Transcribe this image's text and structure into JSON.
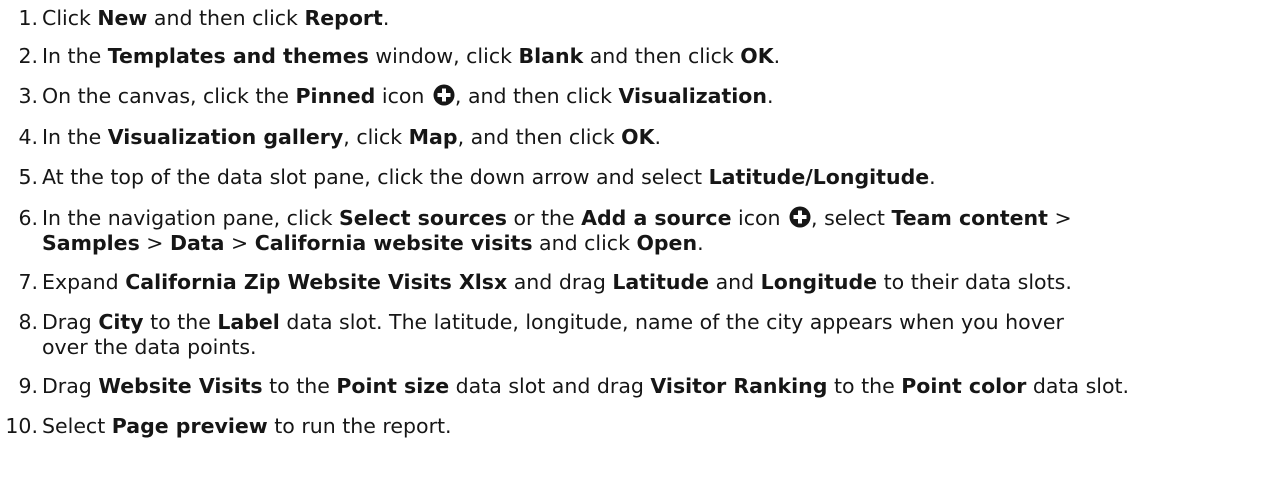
{
  "steps": [
    {
      "num": "1.",
      "segments": [
        {
          "t": "Click "
        },
        {
          "t": "New",
          "b": true
        },
        {
          "t": " and then click "
        },
        {
          "t": "Report",
          "b": true
        },
        {
          "t": "."
        }
      ]
    },
    {
      "num": "2.",
      "segments": [
        {
          "t": "In the "
        },
        {
          "t": "Templates and themes",
          "b": true
        },
        {
          "t": " window, click "
        },
        {
          "t": "Blank",
          "b": true
        },
        {
          "t": " and then click "
        },
        {
          "t": "OK",
          "b": true
        },
        {
          "t": "."
        }
      ]
    },
    {
      "num": "3.",
      "segments": [
        {
          "t": "On the canvas, click the "
        },
        {
          "t": "Pinned",
          "b": true
        },
        {
          "t": " icon "
        },
        {
          "icon": "add-circle-icon"
        },
        {
          "t": ", and then click "
        },
        {
          "t": "Visualization",
          "b": true
        },
        {
          "t": "."
        }
      ]
    },
    {
      "num": "4.",
      "segments": [
        {
          "t": "In the "
        },
        {
          "t": "Visualization gallery",
          "b": true
        },
        {
          "t": ", click "
        },
        {
          "t": "Map",
          "b": true
        },
        {
          "t": ", and then click "
        },
        {
          "t": "OK",
          "b": true
        },
        {
          "t": "."
        }
      ]
    },
    {
      "num": "5.",
      "segments": [
        {
          "t": "At the top of the data slot pane, click the down arrow and select "
        },
        {
          "t": "Latitude/Longitude",
          "b": true
        },
        {
          "t": "."
        }
      ]
    },
    {
      "num": "6.",
      "segments": [
        {
          "t": "In the navigation pane, click "
        },
        {
          "t": "Select sources",
          "b": true
        },
        {
          "t": " or the "
        },
        {
          "t": "Add a source",
          "b": true
        },
        {
          "t": " icon "
        },
        {
          "icon": "add-circle-icon"
        },
        {
          "t": ", select "
        },
        {
          "t": "Team content",
          "b": true
        },
        {
          "t": " >"
        },
        {
          "br": true
        },
        {
          "t": "Samples",
          "b": true
        },
        {
          "t": " > "
        },
        {
          "t": "Data",
          "b": true
        },
        {
          "t": " > "
        },
        {
          "t": "California website visits",
          "b": true
        },
        {
          "t": " and click "
        },
        {
          "t": "Open",
          "b": true
        },
        {
          "t": "."
        }
      ]
    },
    {
      "num": "7.",
      "segments": [
        {
          "t": "Expand "
        },
        {
          "t": "California Zip Website Visits Xlsx",
          "b": true
        },
        {
          "t": " and drag "
        },
        {
          "t": "Latitude",
          "b": true
        },
        {
          "t": " and "
        },
        {
          "t": "Longitude",
          "b": true
        },
        {
          "t": " to their data slots."
        }
      ]
    },
    {
      "num": "8.",
      "segments": [
        {
          "t": "Drag "
        },
        {
          "t": "City",
          "b": true
        },
        {
          "t": " to the "
        },
        {
          "t": "Label",
          "b": true
        },
        {
          "t": " data slot. The latitude, longitude, name of the city appears when you hover"
        },
        {
          "br": true
        },
        {
          "t": "over the data points."
        }
      ]
    },
    {
      "num": "9.",
      "segments": [
        {
          "t": "Drag "
        },
        {
          "t": "Website Visits",
          "b": true
        },
        {
          "t": " to the "
        },
        {
          "t": "Point size",
          "b": true
        },
        {
          "t": " data slot and drag "
        },
        {
          "t": "Visitor Ranking",
          "b": true
        },
        {
          "t": " to the "
        },
        {
          "t": "Point color",
          "b": true
        },
        {
          "t": " data slot."
        }
      ]
    },
    {
      "num": "10.",
      "segments": [
        {
          "t": "Select "
        },
        {
          "t": "Page preview",
          "b": true
        },
        {
          "t": " to run the report."
        }
      ]
    }
  ]
}
